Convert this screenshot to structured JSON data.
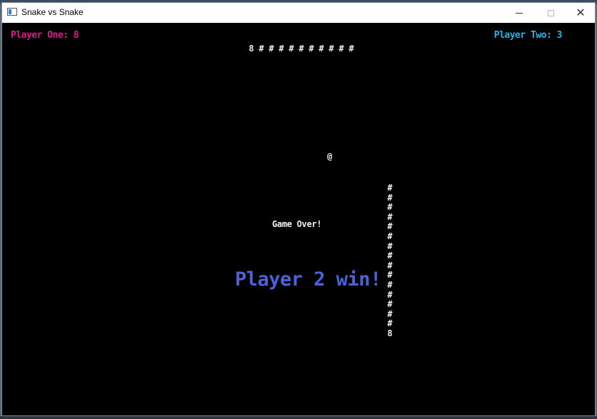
{
  "window": {
    "title": "Snake vs Snake"
  },
  "scores": {
    "player_one": "Player One: 8",
    "player_two": "Player Two: 3",
    "player_one_color": "#e0168c",
    "player_two_color": "#1fb6e8"
  },
  "snake_one": {
    "head": "8",
    "body_glyph": "#",
    "body_count": 10
  },
  "snake_two": {
    "head": "8",
    "body_glyph": "#",
    "body_count": 15
  },
  "food": "@",
  "messages": {
    "game_over": "Game Over!",
    "winner": "Player 2 win!",
    "winner_color": "#4a63d9"
  }
}
